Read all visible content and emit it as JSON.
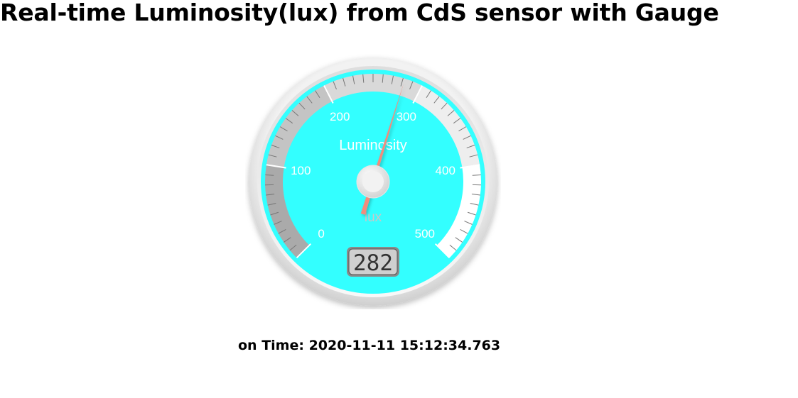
{
  "page": {
    "title": "Real-time Luminosity(lux) from CdS sensor with Gauge"
  },
  "gauge": {
    "title": "Luminosity",
    "units": "lux",
    "value": 282,
    "value_display": "282",
    "min": 0,
    "max": 500,
    "major_ticks": [
      "0",
      "100",
      "200",
      "300",
      "400",
      "500"
    ],
    "minor_ticks_per_major": 10,
    "highlights": [
      {
        "from": 0,
        "to": 100,
        "color": "#aaaaaa"
      },
      {
        "from": 100,
        "to": 200,
        "color": "#c4c4c4"
      },
      {
        "from": 200,
        "to": 300,
        "color": "#d9d9d9"
      },
      {
        "from": 300,
        "to": 400,
        "color": "#eeeeee"
      },
      {
        "from": 400,
        "to": 500,
        "color": "#ffffff"
      }
    ],
    "colors": {
      "plate": "#33ffff",
      "needle": "#f28c7c",
      "label_text": "#ffffff",
      "units_text": "#c8c8c8",
      "value_box": "#7c7c7c",
      "value_text": "#333333"
    }
  },
  "timestamp": {
    "label": "on Time: 2020-11-11 15:12:34.763"
  }
}
